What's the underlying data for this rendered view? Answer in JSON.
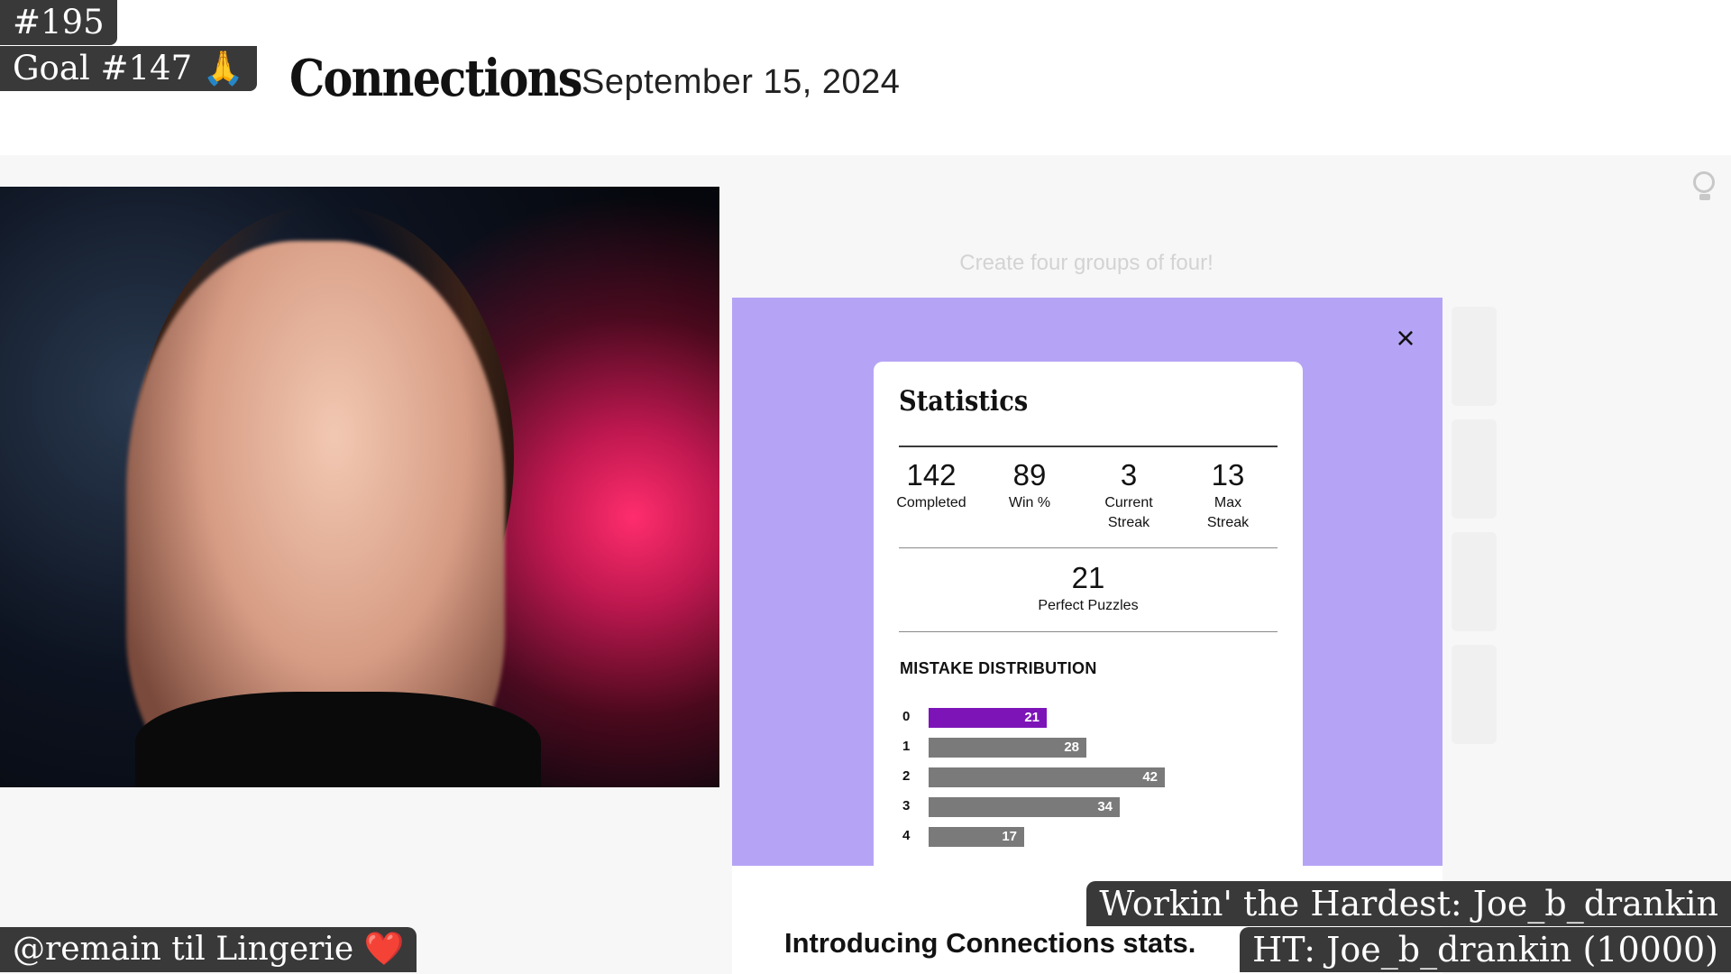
{
  "overlay": {
    "number": "#195",
    "goal": "Goal #147",
    "goal_emoji": "🙏",
    "remain": "@remain til Lingerie",
    "remain_emoji": "❤️",
    "workin": "Workin' the Hardest: Joe_b_drankin",
    "ht": "HT: Joe_b_drankin (10000)"
  },
  "header": {
    "brand": "Connections",
    "date": "September 15, 2024"
  },
  "game": {
    "subtitle": "Create four groups of four!",
    "hint_icon": "lightbulb-icon"
  },
  "modal": {
    "close_label": "×",
    "title": "Statistics",
    "stats": [
      {
        "value": "142",
        "label": "Completed"
      },
      {
        "value": "89",
        "label": "Win %"
      },
      {
        "value": "3",
        "label": "Current Streak"
      },
      {
        "value": "13",
        "label": "Max Streak"
      }
    ],
    "perfect": {
      "value": "21",
      "label": "Perfect Puzzles"
    },
    "distribution_title": "MISTAKE DISTRIBUTION",
    "distribution_max": 42,
    "distribution": [
      {
        "mistakes": "0",
        "count": 21,
        "highlight": true
      },
      {
        "mistakes": "1",
        "count": 28,
        "highlight": false
      },
      {
        "mistakes": "2",
        "count": 42,
        "highlight": false
      },
      {
        "mistakes": "3",
        "count": 34,
        "highlight": false
      },
      {
        "mistakes": "4",
        "count": 17,
        "highlight": false
      }
    ],
    "colors": {
      "backdrop": "#b5a4f5",
      "best_bar": "#7d14b8",
      "bar": "#7a7a7a"
    }
  },
  "footer": {
    "text": "Introducing Connections stats."
  }
}
